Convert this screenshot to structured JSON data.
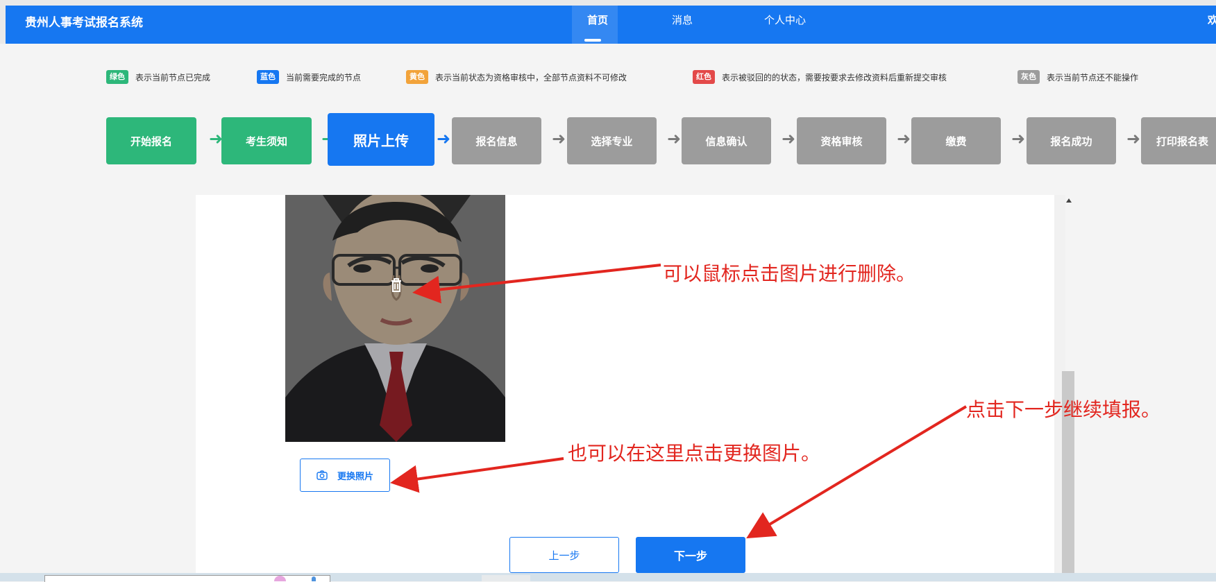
{
  "header": {
    "brand": "贵州人事考试报名系统",
    "nav": [
      "首页",
      "消息",
      "个人中心"
    ],
    "right_fragment": "欢"
  },
  "legend": [
    {
      "badge": "绿色",
      "text": "表示当前节点已完成",
      "color": "#2db77a"
    },
    {
      "badge": "蓝色",
      "text": "当前需要完成的节点",
      "color": "#1677f1"
    },
    {
      "badge": "黄色",
      "text": "表示当前状态为资格审核中，全部节点资料不可修改",
      "color": "#f2a33a"
    },
    {
      "badge": "红色",
      "text": "表示被驳回的的状态，需要按要求去修改资料后重新提交审核",
      "color": "#e34949"
    },
    {
      "badge": "灰色",
      "text": "表示当前节点还不能操作",
      "color": "#9c9c9c"
    }
  ],
  "steps": [
    {
      "label": "开始报名",
      "state": "done"
    },
    {
      "label": "考生须知",
      "state": "done"
    },
    {
      "label": "照片上传",
      "state": "current"
    },
    {
      "label": "报名信息",
      "state": "pending"
    },
    {
      "label": "选择专业",
      "state": "pending"
    },
    {
      "label": "信息确认",
      "state": "pending"
    },
    {
      "label": "资格审核",
      "state": "pending"
    },
    {
      "label": "缴费",
      "state": "pending"
    },
    {
      "label": "报名成功",
      "state": "pending"
    },
    {
      "label": "打印报名表",
      "state": "pending"
    }
  ],
  "colors": {
    "done": "#2db77a",
    "current": "#1677f1",
    "pending": "#9c9c9c",
    "arrow_done": "#2db77a",
    "arrow_current": "#1677f1",
    "arrow_pending": "#7a7a7a",
    "annotation": "#e2261f"
  },
  "content": {
    "change_photo_label": "更换照片",
    "prev_label": "上一步",
    "next_label": "下一步"
  },
  "annotations": {
    "delete_hint": "可以鼠标点击图片进行删除。",
    "change_hint": "也可以在这里点击更换图片。",
    "next_hint": "点击下一步继续填报。"
  }
}
